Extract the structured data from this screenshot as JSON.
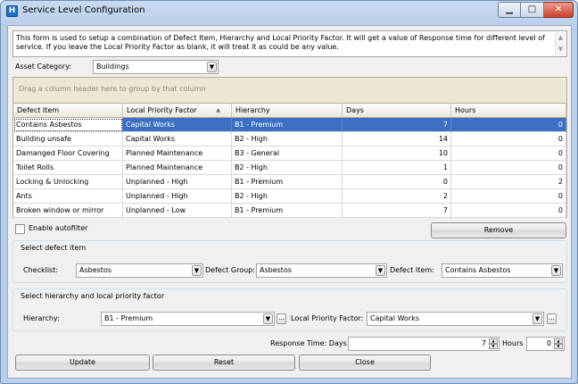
{
  "window": {
    "title": "Service Level Configuration",
    "minimize_glyph": "▁",
    "maximize_glyph": "□",
    "close_glyph": "✕",
    "app_icon_glyph": "H"
  },
  "description": "This form is used to setup a combination of Defect Item, Hierarchy and Local Priority Factor. It will get a value of Response time for different level of service. If you leave the Local Priority Factor as blank, it will treat it as could be any value.",
  "asset_category": {
    "label": "Asset Category:",
    "value": "Buildings"
  },
  "grid": {
    "group_hint": "Drag a column header here to group by that column",
    "columns": [
      "Defect Item",
      "Local Priority Factor",
      "Hierarchy",
      "Days",
      "Hours"
    ],
    "sorted_column": "Local Priority Factor",
    "sort_direction": "ascending",
    "selected_row": 0,
    "rows": [
      [
        "Contains Asbestos",
        "Capital Works",
        "B1 - Premium",
        "7",
        "0"
      ],
      [
        "Building unsafe",
        "Capital Works",
        "B2 - High",
        "14",
        "0"
      ],
      [
        "Damanged Floor Covering",
        "Planned Maintenance",
        "B3 - General",
        "10",
        "0"
      ],
      [
        "Toilet Rolls",
        "Planned Maintenance",
        "B2 - High",
        "1",
        "0"
      ],
      [
        "Locking & Unlocking",
        "Unplanned - High",
        "B1 - Premium",
        "0",
        "2"
      ],
      [
        "Ants",
        "Unplanned - High",
        "B2 - High",
        "2",
        "0"
      ],
      [
        "Broken window or mirror",
        "Unplanned - Low",
        "B1 - Premium",
        "7",
        "0"
      ]
    ]
  },
  "enable_autofilter": {
    "label": "Enable autofilter",
    "checked": false
  },
  "remove_button": "Remove",
  "defect_group_box": {
    "title": "Select defect item",
    "checklist_label": "Checklist:",
    "checklist_value": "Asbestos",
    "defect_group_label": "Defect Group:",
    "defect_group_value": "Asbestos",
    "defect_item_label": "Defect Item:",
    "defect_item_value": "Contains Asbestos"
  },
  "hierarchy_group_box": {
    "title": "Select hierarchy and local priority factor",
    "hierarchy_label": "Hierarchy:",
    "hierarchy_value": "B1 - Premium",
    "lpf_label": "Local Priority Factor:",
    "lpf_value": "Capital Works"
  },
  "response_time": {
    "days_label": "Response Time: Days",
    "days_value": "7",
    "hours_label": "Hours",
    "hours_value": "0"
  },
  "buttons": {
    "update": "Update",
    "reset": "Reset",
    "close": "Close"
  },
  "colors": {
    "selection": "#3b6fc2",
    "grid_area": "#ece6d6",
    "client": "#f0f0f0"
  }
}
